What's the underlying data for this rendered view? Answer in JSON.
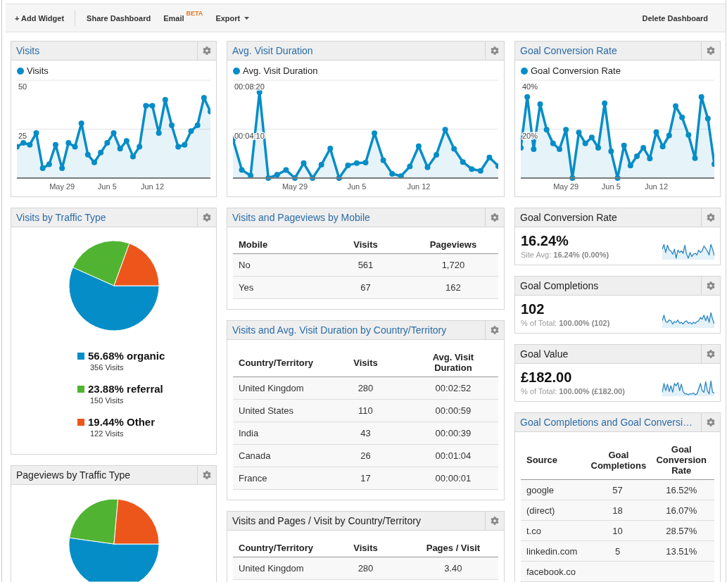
{
  "toolbar": {
    "actions": [
      {
        "label": "+ Add Widget",
        "separator_after": true,
        "dropdown": false
      },
      {
        "label": "Share Dashboard",
        "separator_after": false,
        "dropdown": false
      },
      {
        "label": "Email",
        "badge": "BETA",
        "separator_after": false,
        "dropdown": false
      },
      {
        "label": "Export",
        "separator_after": false,
        "dropdown": true
      }
    ],
    "right_actions": [
      {
        "label": "Delete Dashboard"
      }
    ]
  },
  "columns": [
    {
      "widgets": [
        {
          "kind": "line_chart",
          "title": "Visits",
          "linked": true,
          "chart_data": {
            "type": "area",
            "categories": [
              null,
              null,
              null,
              null,
              null,
              null,
              null,
              "May 29",
              null,
              null,
              null,
              null,
              null,
              null,
              "Jun 5",
              null,
              null,
              null,
              null,
              null,
              null,
              "Jun 12",
              null,
              null,
              null,
              null,
              null,
              null,
              null,
              null,
              null
            ],
            "series": [
              {
                "name": "Visits",
                "color": "#058dc7",
                "values": [
                  16,
                  18,
                  17,
                  23,
                  5,
                  7,
                  17,
                  5,
                  18,
                  16,
                  28,
                  12,
                  8,
                  13,
                  18,
                  23,
                  15,
                  19,
                  11,
                  16,
                  37,
                  37,
                  23,
                  40,
                  27,
                  16,
                  17,
                  24,
                  27,
                  41,
                  34
                ]
              }
            ],
            "yticks": [
              25,
              50
            ],
            "ylim": [
              0,
              50
            ]
          }
        },
        {
          "kind": "pie_chart",
          "title": "Visits by Traffic Type",
          "linked": true,
          "chart_data": {
            "type": "pie",
            "categories": [
              "organic",
              "referral",
              "Other"
            ],
            "values": [
              56.68,
              23.88,
              19.44
            ]
          },
          "legend": [
            {
              "percent": "56.68%",
              "detail": "356 Visits",
              "color": "#058dc7"
            },
            {
              "percent": "23.88%",
              "detail": "150 Visits",
              "color": "#50b432"
            },
            {
              "percent": "19.44%",
              "detail": "122 Visits",
              "color": "#ed561b"
            }
          ]
        },
        {
          "kind": "pie_picture",
          "title": "Pageviews by Traffic Type",
          "linked": false
        }
      ]
    },
    {
      "widgets": [
        {
          "kind": "line_chart",
          "title": "Avg. Visit Duration",
          "linked": true,
          "chart_data": {
            "type": "area",
            "categories": [
              null,
              null,
              null,
              null,
              null,
              null,
              null,
              "May 29",
              null,
              null,
              null,
              null,
              null,
              null,
              "Jun 5",
              null,
              null,
              null,
              null,
              null,
              null,
              "Jun 12",
              null,
              null,
              null,
              null,
              null,
              null,
              null,
              null,
              null
            ],
            "series": [
              {
                "name": "Avg. Visit Duration",
                "color": "#058dc7",
                "values": [
                  199,
                  41,
                  13,
                  439,
                  0,
                  17,
                  41,
                  0,
                  76,
                  0,
                  68,
                  151,
                  0,
                  65,
                  76,
                  79,
                  229,
                  91,
                  22,
                  10,
                  59,
                  163,
                  55,
                  119,
                  247,
                  149,
                  82,
                  46,
                  37,
                  105,
                  61
                ]
              }
            ],
            "yticks": [
              {
                "value": 250,
                "label": "00:04:10"
              },
              {
                "value": 500,
                "label": "00:08:20"
              }
            ],
            "ylim": [
              0,
              500
            ]
          }
        },
        {
          "kind": "table",
          "title": "Visits and Pageviews by Mobile",
          "linked": true,
          "columns": [
            "Mobile",
            "Visits",
            "Pageviews"
          ],
          "rows": [
            [
              "No",
              "561",
              "1,720"
            ],
            [
              "Yes",
              "67",
              "162"
            ]
          ]
        },
        {
          "kind": "table",
          "title": "Visits and Avg. Visit Duration by Country/Territory",
          "linked": true,
          "columns": [
            "Country/Territory",
            "Visits",
            "Avg. Visit Duration"
          ],
          "rows": [
            [
              "United Kingdom",
              "280",
              "00:02:52"
            ],
            [
              "United States",
              "110",
              "00:00:59"
            ],
            [
              "India",
              "43",
              "00:00:39"
            ],
            [
              "Canada",
              "26",
              "00:01:04"
            ],
            [
              "France",
              "17",
              "00:00:01"
            ]
          ]
        },
        {
          "kind": "table",
          "title": "Visits and Pages / Visit by Country/Territory",
          "linked": false,
          "columns": [
            "Country/Territory",
            "Visits",
            "Pages / Visit"
          ],
          "rows": [
            [
              "United Kingdom",
              "280",
              "3.40"
            ]
          ]
        }
      ]
    },
    {
      "widgets": [
        {
          "kind": "line_chart",
          "title": "Goal Conversion Rate",
          "linked": true,
          "chart_data": {
            "type": "area",
            "categories": [
              null,
              null,
              null,
              null,
              null,
              null,
              null,
              "May 29",
              null,
              null,
              null,
              null,
              null,
              null,
              "Jun 5",
              null,
              null,
              null,
              null,
              null,
              null,
              "Jun 12",
              null,
              null,
              null,
              null,
              null,
              null,
              null,
              null,
              null
            ],
            "series": [
              {
                "name": "Goal Conversion Rate",
                "color": "#058dc7",
                "values": [
                  12.4,
                  33.2,
                  11.8,
                  30.2,
                  19.8,
                  14.2,
                  11.8,
                  19.8,
                  0,
                  18.6,
                  14.2,
                  16.6,
                  12.4,
                  30.6,
                  10.9,
                  0,
                  13.3,
                  5.1,
                  8.9,
                  12.4,
                  8,
                  18.8,
                  12.9,
                  17.4,
                  29.4,
                  24.8,
                  17.6,
                  8.1,
                  33.2,
                  24.3,
                  5.7
                ]
              }
            ],
            "yticks": [
              {
                "value": 20,
                "label": "20%"
              },
              {
                "value": 40,
                "label": "40%"
              }
            ],
            "ylim": [
              0,
              40
            ]
          }
        },
        {
          "kind": "metric",
          "title": "Goal Conversion Rate",
          "linked": false,
          "value": "16.24%",
          "comparison": "Site Avg: **16.24% (0.00%)**"
        },
        {
          "kind": "metric",
          "title": "Goal Completions",
          "linked": false,
          "value": "102",
          "comparison": "% of Total: **100.00% (102)**"
        },
        {
          "kind": "metric",
          "title": "Goal Value",
          "linked": false,
          "value": "£182.00",
          "comparison": "% of Total: **100.00% (£182.00)**"
        },
        {
          "kind": "table",
          "title": "Goal Completions and Goal Conversi…",
          "linked": true,
          "columns": [
            "Source",
            "Goal Completions",
            "Goal Conversion Rate"
          ],
          "rows": [
            [
              "google",
              "57",
              "16.52%"
            ],
            [
              "(direct)",
              "18",
              "16.07%"
            ],
            [
              "t.co",
              "10",
              "28.57%"
            ],
            [
              "linkedin.com",
              "5",
              "13.51%"
            ],
            [
              "facebook.co"
            ]
          ]
        }
      ]
    }
  ]
}
